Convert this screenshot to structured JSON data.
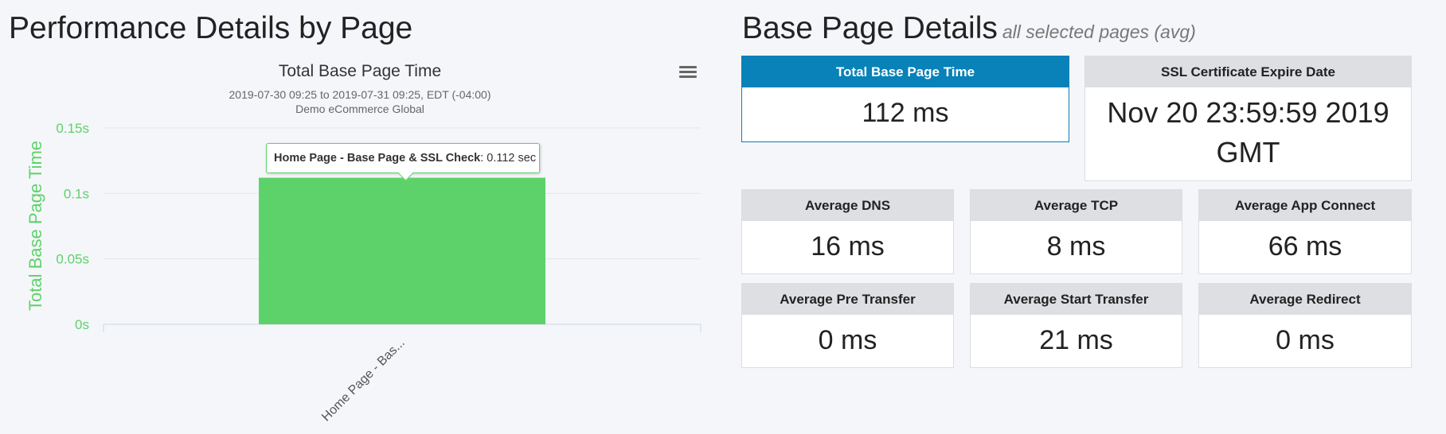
{
  "left": {
    "title": "Performance Details by Page",
    "menu_icon": "hamburger-menu-icon"
  },
  "right": {
    "title": "Base Page Details",
    "subtitle": "all selected pages (avg)"
  },
  "chart_data": {
    "type": "bar",
    "title": "Total Base Page Time",
    "subtitle_lines": [
      "2019-07-30 09:25 to 2019-07-31 09:25, EDT (-04:00)",
      "Demo eCommerce Global"
    ],
    "ylabel": "Total Base Page Time",
    "xlabel": "",
    "categories": [
      "Home Page - Bas..."
    ],
    "values": [
      0.112
    ],
    "ylim": [
      0,
      0.15
    ],
    "yticks": [
      0,
      0.05,
      0.1,
      0.15
    ],
    "ytick_labels": [
      "0s",
      "0.05s",
      "0.1s",
      "0.15s"
    ],
    "bar_color": "#5ed26a",
    "ylabel_color": "#5ed26a",
    "grid": true,
    "tooltip": {
      "label": "Home Page - Base Page & SSL Check",
      "value": ": 0.112 sec"
    }
  },
  "metrics": {
    "total_base_page_time": {
      "label": "Total Base Page Time",
      "value": "112 ms"
    },
    "ssl_expire": {
      "label": "SSL Certificate Expire Date",
      "value_line1": "Nov 20 23:59:59 2019",
      "value_line2": "GMT"
    },
    "avg_dns": {
      "label": "Average DNS",
      "value": "16 ms"
    },
    "avg_tcp": {
      "label": "Average TCP",
      "value": "8 ms"
    },
    "avg_app_connect": {
      "label": "Average App Connect",
      "value": "66 ms"
    },
    "avg_pre_transfer": {
      "label": "Average Pre Transfer",
      "value": "0 ms"
    },
    "avg_start_transfer": {
      "label": "Average Start Transfer",
      "value": "21 ms"
    },
    "avg_redirect": {
      "label": "Average Redirect",
      "value": "0 ms"
    }
  },
  "colors": {
    "accent": "#0882b8",
    "bar": "#5ed26a"
  }
}
